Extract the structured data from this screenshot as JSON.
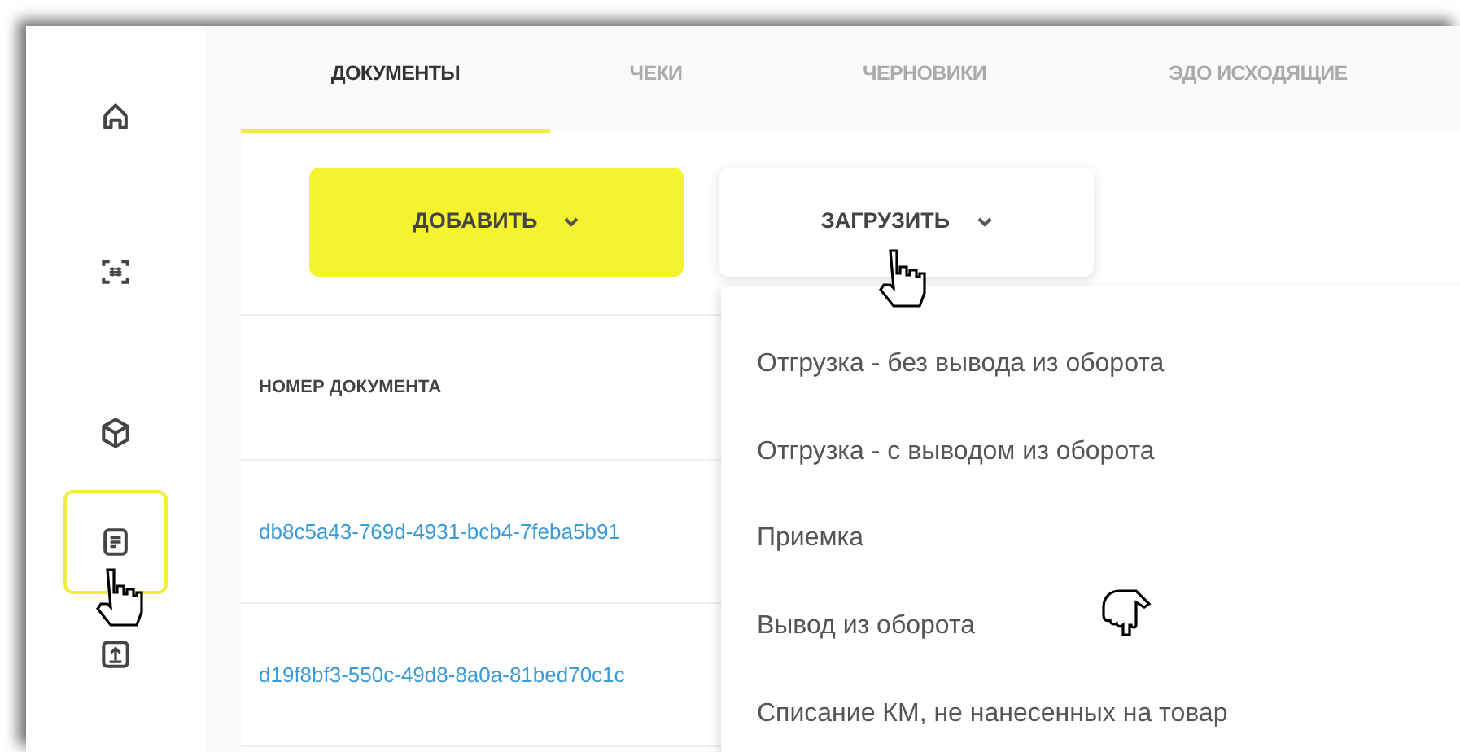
{
  "sidebar": {
    "items": [
      {
        "kind": "home",
        "selected": false
      },
      {
        "kind": "scan",
        "selected": false
      },
      {
        "kind": "box",
        "selected": false
      },
      {
        "kind": "document",
        "selected": true
      },
      {
        "kind": "upload",
        "selected": false
      }
    ]
  },
  "tabs": [
    {
      "label": "ДОКУМЕНТЫ",
      "selected": true
    },
    {
      "label": "ЧЕКИ",
      "selected": false
    },
    {
      "label": "ЧЕРНОВИКИ",
      "selected": false
    },
    {
      "label": "ЭДО ИСХОДЯЩИЕ",
      "selected": false
    }
  ],
  "buttons": [
    {
      "label": "ДОБАВИТЬ",
      "kind": "primary",
      "expanded": false
    },
    {
      "label": "ЗАГРУЗИТЬ",
      "kind": "secondary",
      "expanded": true
    }
  ],
  "table": {
    "columns": [
      "НОМЕР ДОКУМЕНТА"
    ],
    "rows": [
      [
        "db8c5a43-769d-4931-bcb4-7feba5b91"
      ],
      [
        "d19f8bf3-550c-49d8-8a0a-81bed70c1c"
      ]
    ]
  },
  "dropdown": {
    "items": [
      "Отгрузка - без вывода из оборота",
      "Отгрузка - с выводом из оборота",
      "Приемка",
      "Вывод из оборота",
      "Списание КМ, не нанесенных на товар"
    ]
  }
}
